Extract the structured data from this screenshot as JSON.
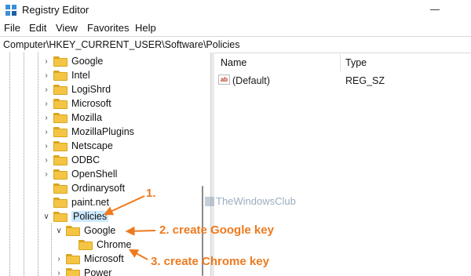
{
  "window": {
    "title": "Registry Editor",
    "icon": "registry-editor-icon"
  },
  "menu": [
    "File",
    "Edit",
    "View",
    "Favorites",
    "Help"
  ],
  "address": "Computer\\HKEY_CURRENT_USER\\Software\\Policies",
  "tree": {
    "nodes": [
      {
        "label": "Google",
        "chevron": "›"
      },
      {
        "label": "Intel",
        "chevron": "›"
      },
      {
        "label": "LogiShrd",
        "chevron": "›"
      },
      {
        "label": "Microsoft",
        "chevron": "›"
      },
      {
        "label": "Mozilla",
        "chevron": "›"
      },
      {
        "label": "MozillaPlugins",
        "chevron": "›"
      },
      {
        "label": "Netscape",
        "chevron": "›"
      },
      {
        "label": "ODBC",
        "chevron": "›"
      },
      {
        "label": "OpenShell",
        "chevron": "›"
      },
      {
        "label": "Ordinarysoft",
        "chevron": ""
      },
      {
        "label": "paint.net",
        "chevron": ""
      },
      {
        "label": "Policies",
        "chevron": "∨",
        "selected": true
      },
      {
        "label": "Google",
        "chevron": "∨"
      },
      {
        "label": "Chrome",
        "chevron": ""
      },
      {
        "label": "Microsoft",
        "chevron": "›"
      },
      {
        "label": "Power",
        "chevron": "›"
      }
    ]
  },
  "values": {
    "headers": {
      "name": "Name",
      "type": "Type"
    },
    "rows": [
      {
        "icon": "string-value-icon",
        "icon_text": "ab",
        "name": "(Default)",
        "type": "REG_SZ"
      }
    ]
  },
  "watermark": "TheWindowsClub",
  "annotations": {
    "step1": "1.",
    "step2": "2. create Google key",
    "step3": "3. create Chrome key",
    "color": "#ee7a1e"
  },
  "colors": {
    "folder": "#f4c544",
    "selection": "#cce8ff",
    "accent": "#ee7a1e"
  }
}
